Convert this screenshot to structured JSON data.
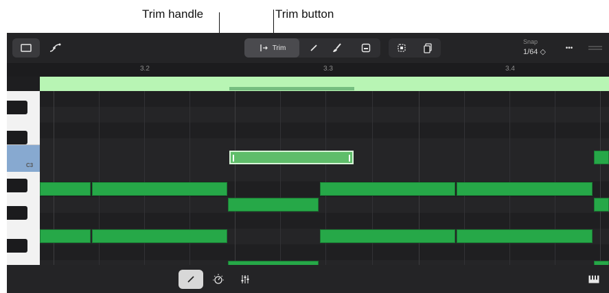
{
  "callouts": {
    "trim_handle": "Trim handle",
    "trim_button": "Trim button"
  },
  "toolbar": {
    "trim_label": "Trim",
    "snap_label": "Snap",
    "snap_value": "1/64 ◇",
    "more_label": "•••"
  },
  "ruler": {
    "bars": [
      "3.2",
      "3.3",
      "3.4"
    ]
  },
  "keys": {
    "c3_label": "C3"
  },
  "colors": {
    "note": "#26a848",
    "region": "#b8f5b4",
    "background": "#1e1e20"
  }
}
